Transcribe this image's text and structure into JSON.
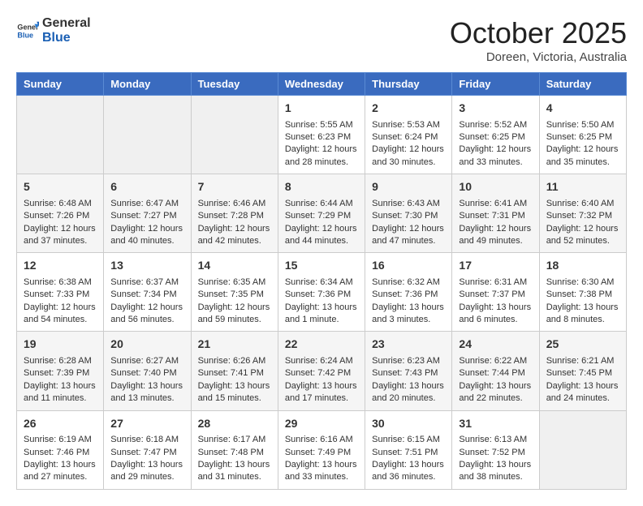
{
  "header": {
    "logo_line1": "General",
    "logo_line2": "Blue",
    "month": "October 2025",
    "location": "Doreen, Victoria, Australia"
  },
  "days_of_week": [
    "Sunday",
    "Monday",
    "Tuesday",
    "Wednesday",
    "Thursday",
    "Friday",
    "Saturday"
  ],
  "weeks": [
    [
      {
        "day": "",
        "info": ""
      },
      {
        "day": "",
        "info": ""
      },
      {
        "day": "",
        "info": ""
      },
      {
        "day": "1",
        "info": "Sunrise: 5:55 AM\nSunset: 6:23 PM\nDaylight: 12 hours\nand 28 minutes."
      },
      {
        "day": "2",
        "info": "Sunrise: 5:53 AM\nSunset: 6:24 PM\nDaylight: 12 hours\nand 30 minutes."
      },
      {
        "day": "3",
        "info": "Sunrise: 5:52 AM\nSunset: 6:25 PM\nDaylight: 12 hours\nand 33 minutes."
      },
      {
        "day": "4",
        "info": "Sunrise: 5:50 AM\nSunset: 6:25 PM\nDaylight: 12 hours\nand 35 minutes."
      }
    ],
    [
      {
        "day": "5",
        "info": "Sunrise: 6:48 AM\nSunset: 7:26 PM\nDaylight: 12 hours\nand 37 minutes."
      },
      {
        "day": "6",
        "info": "Sunrise: 6:47 AM\nSunset: 7:27 PM\nDaylight: 12 hours\nand 40 minutes."
      },
      {
        "day": "7",
        "info": "Sunrise: 6:46 AM\nSunset: 7:28 PM\nDaylight: 12 hours\nand 42 minutes."
      },
      {
        "day": "8",
        "info": "Sunrise: 6:44 AM\nSunset: 7:29 PM\nDaylight: 12 hours\nand 44 minutes."
      },
      {
        "day": "9",
        "info": "Sunrise: 6:43 AM\nSunset: 7:30 PM\nDaylight: 12 hours\nand 47 minutes."
      },
      {
        "day": "10",
        "info": "Sunrise: 6:41 AM\nSunset: 7:31 PM\nDaylight: 12 hours\nand 49 minutes."
      },
      {
        "day": "11",
        "info": "Sunrise: 6:40 AM\nSunset: 7:32 PM\nDaylight: 12 hours\nand 52 minutes."
      }
    ],
    [
      {
        "day": "12",
        "info": "Sunrise: 6:38 AM\nSunset: 7:33 PM\nDaylight: 12 hours\nand 54 minutes."
      },
      {
        "day": "13",
        "info": "Sunrise: 6:37 AM\nSunset: 7:34 PM\nDaylight: 12 hours\nand 56 minutes."
      },
      {
        "day": "14",
        "info": "Sunrise: 6:35 AM\nSunset: 7:35 PM\nDaylight: 12 hours\nand 59 minutes."
      },
      {
        "day": "15",
        "info": "Sunrise: 6:34 AM\nSunset: 7:36 PM\nDaylight: 13 hours\nand 1 minute."
      },
      {
        "day": "16",
        "info": "Sunrise: 6:32 AM\nSunset: 7:36 PM\nDaylight: 13 hours\nand 3 minutes."
      },
      {
        "day": "17",
        "info": "Sunrise: 6:31 AM\nSunset: 7:37 PM\nDaylight: 13 hours\nand 6 minutes."
      },
      {
        "day": "18",
        "info": "Sunrise: 6:30 AM\nSunset: 7:38 PM\nDaylight: 13 hours\nand 8 minutes."
      }
    ],
    [
      {
        "day": "19",
        "info": "Sunrise: 6:28 AM\nSunset: 7:39 PM\nDaylight: 13 hours\nand 11 minutes."
      },
      {
        "day": "20",
        "info": "Sunrise: 6:27 AM\nSunset: 7:40 PM\nDaylight: 13 hours\nand 13 minutes."
      },
      {
        "day": "21",
        "info": "Sunrise: 6:26 AM\nSunset: 7:41 PM\nDaylight: 13 hours\nand 15 minutes."
      },
      {
        "day": "22",
        "info": "Sunrise: 6:24 AM\nSunset: 7:42 PM\nDaylight: 13 hours\nand 17 minutes."
      },
      {
        "day": "23",
        "info": "Sunrise: 6:23 AM\nSunset: 7:43 PM\nDaylight: 13 hours\nand 20 minutes."
      },
      {
        "day": "24",
        "info": "Sunrise: 6:22 AM\nSunset: 7:44 PM\nDaylight: 13 hours\nand 22 minutes."
      },
      {
        "day": "25",
        "info": "Sunrise: 6:21 AM\nSunset: 7:45 PM\nDaylight: 13 hours\nand 24 minutes."
      }
    ],
    [
      {
        "day": "26",
        "info": "Sunrise: 6:19 AM\nSunset: 7:46 PM\nDaylight: 13 hours\nand 27 minutes."
      },
      {
        "day": "27",
        "info": "Sunrise: 6:18 AM\nSunset: 7:47 PM\nDaylight: 13 hours\nand 29 minutes."
      },
      {
        "day": "28",
        "info": "Sunrise: 6:17 AM\nSunset: 7:48 PM\nDaylight: 13 hours\nand 31 minutes."
      },
      {
        "day": "29",
        "info": "Sunrise: 6:16 AM\nSunset: 7:49 PM\nDaylight: 13 hours\nand 33 minutes."
      },
      {
        "day": "30",
        "info": "Sunrise: 6:15 AM\nSunset: 7:51 PM\nDaylight: 13 hours\nand 36 minutes."
      },
      {
        "day": "31",
        "info": "Sunrise: 6:13 AM\nSunset: 7:52 PM\nDaylight: 13 hours\nand 38 minutes."
      },
      {
        "day": "",
        "info": ""
      }
    ]
  ]
}
